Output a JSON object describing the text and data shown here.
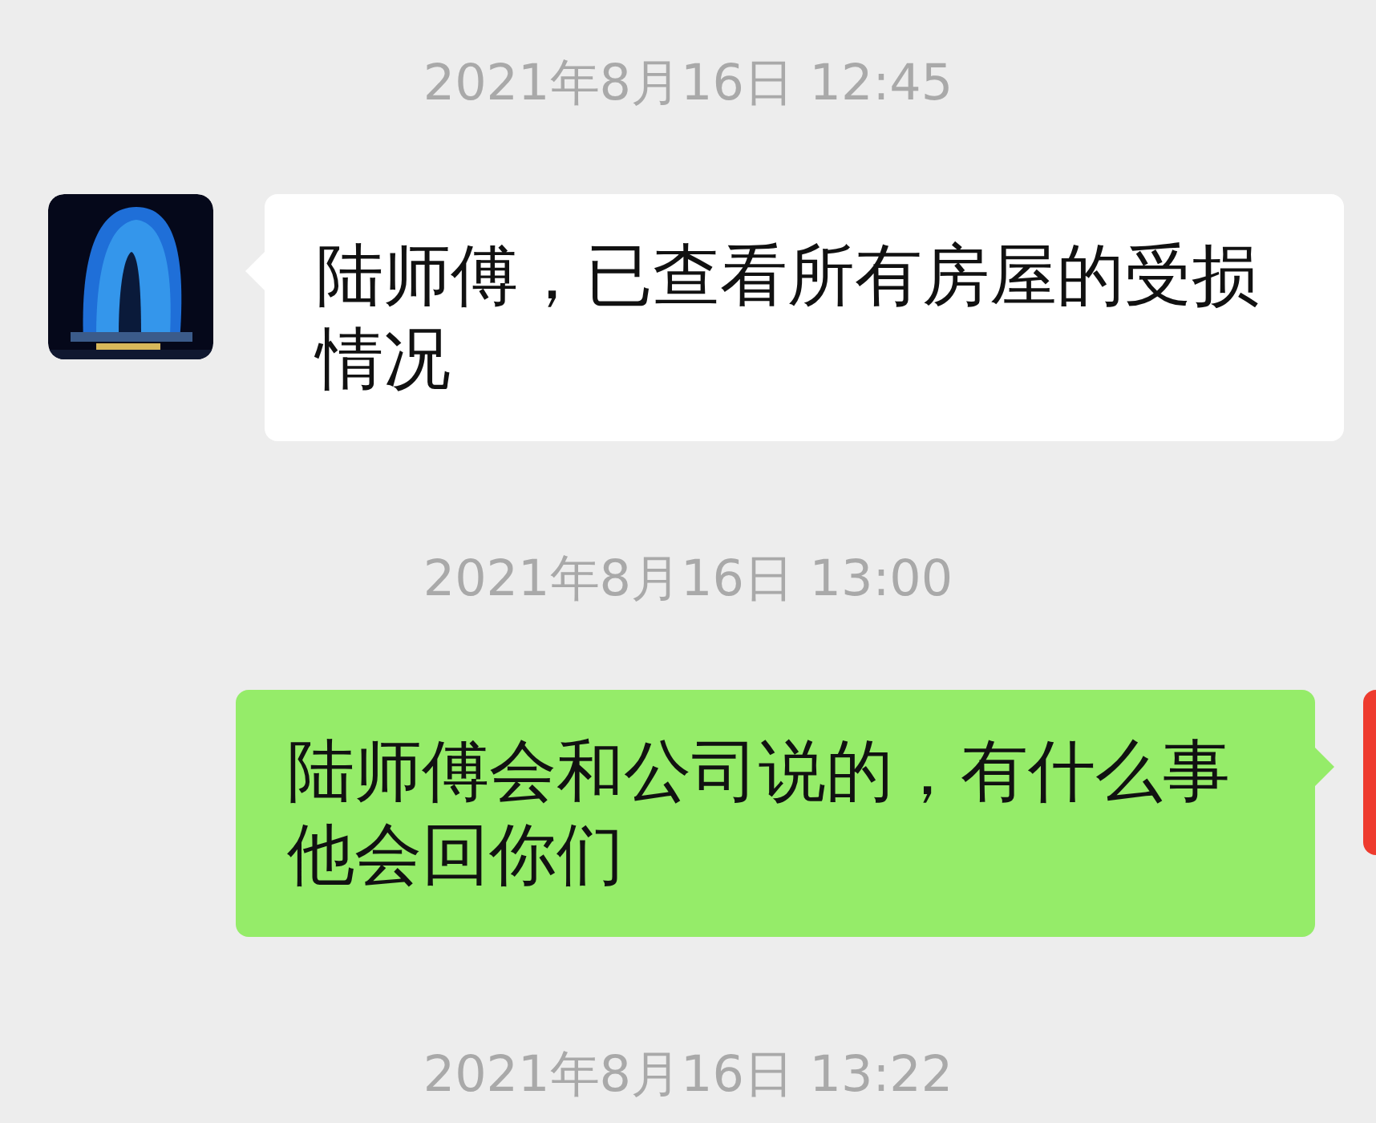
{
  "chat": [
    {
      "kind": "time",
      "text": "2021年8月16日 12:45"
    },
    {
      "kind": "incoming",
      "text": "陆师傅，已查看所有房屋的受损情况"
    },
    {
      "kind": "time",
      "text": "2021年8月16日 13:00"
    },
    {
      "kind": "outgoing",
      "text": "陆师傅会和公司说的，有什么事他会回你们"
    },
    {
      "kind": "time",
      "text": "2021年8月16日 13:22"
    }
  ]
}
